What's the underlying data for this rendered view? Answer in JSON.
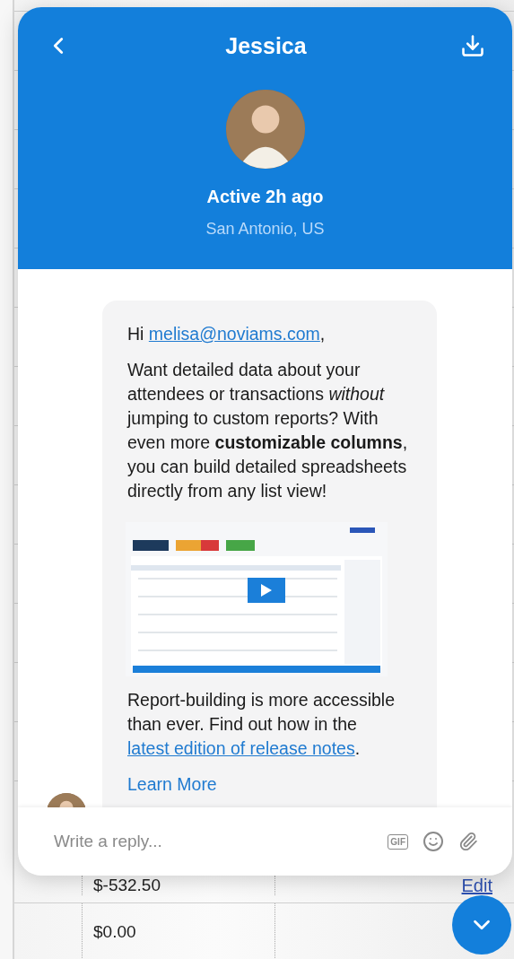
{
  "background": {
    "rows": [
      {
        "amount": "$-532.50",
        "action": "Edit"
      },
      {
        "amount": "$0.00"
      }
    ]
  },
  "chat": {
    "header": {
      "title": "Jessica"
    },
    "profile": {
      "status": "Active 2h ago",
      "location": "San Antonio, US"
    },
    "message": {
      "blocks": [
        {
          "kind": "text",
          "segments": [
            {
              "text": "Hi "
            },
            {
              "text": "melisa@noviams.com",
              "link": true
            },
            {
              "text": ","
            }
          ]
        },
        {
          "kind": "text",
          "segments": [
            {
              "text": "Want detailed data about your attendees or transactions *without* jumping to custom reports? With even more **customizable columns**, you can build detailed spreadsheets directly from any list view!"
            }
          ]
        },
        {
          "kind": "picture"
        },
        {
          "kind": "text",
          "segments": [
            {
              "text": "Report-building is more accessible than ever. Find out how in the "
            },
            {
              "text": "latest edition of release notes",
              "link": true
            },
            {
              "text": "."
            }
          ]
        },
        {
          "kind": "link",
          "text": "Learn More"
        }
      ]
    },
    "composer": {
      "placeholder": "Write a reply...",
      "gif_label": "GIF"
    }
  }
}
